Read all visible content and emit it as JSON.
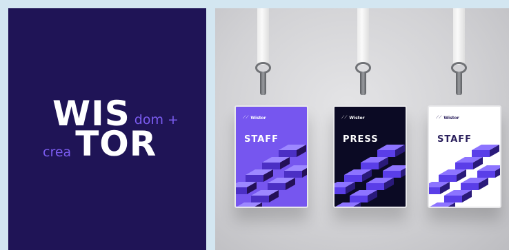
{
  "brand": {
    "line1_big": "WIS",
    "line1_small": "dom +",
    "line2_small": "crea",
    "line2_big": "TOR"
  },
  "badges": [
    {
      "role": "STAFF",
      "logo_text": "Wistor",
      "bg": "#7656ef",
      "text_color": "#ffffff",
      "shape_a": "#4b2fc4",
      "shape_b": "#9d88ff",
      "shape_c": "#241057"
    },
    {
      "role": "PRESS",
      "logo_text": "Wistor",
      "bg": "#0b0a24",
      "text_color": "#ffffff",
      "shape_a": "#5a3ee8",
      "shape_b": "#8d74ff",
      "shape_c": "#2a1a7a"
    },
    {
      "role": "STAFF",
      "logo_text": "Wistor",
      "bg": "#ffffff",
      "text_color": "#2a1f5c",
      "shape_a": "#5a3ee8",
      "shape_b": "#8d74ff",
      "shape_c": "#2a1a7a"
    }
  ],
  "colors": {
    "page_bg": "#d3e6f1",
    "brand_panel": "#1f1456",
    "accent": "#7b5cf0"
  },
  "icons": {
    "badge_logo": "wistor-logo-icon"
  }
}
